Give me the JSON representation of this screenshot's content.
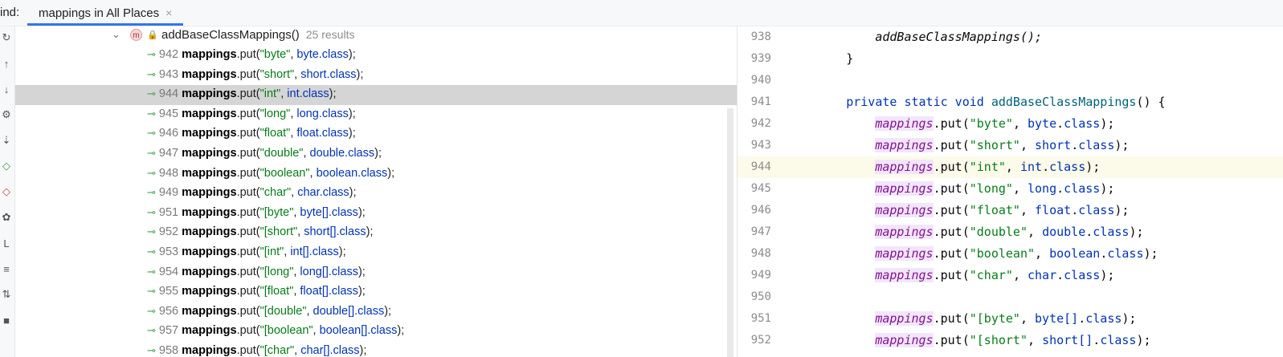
{
  "find": {
    "label": "ind:",
    "tab_label": "mappings in All Places",
    "close": "×"
  },
  "toolbar": {
    "icons": [
      "refresh-icon",
      "arrow-up-icon",
      "arrow-down-icon",
      "settings-icon",
      "tree-icon",
      "diamond-green-icon",
      "diamond-red-icon",
      "filter-icon",
      "text-icon",
      "align-icon",
      "sort-icon",
      "square-icon"
    ]
  },
  "tree": {
    "chevron": "⌄",
    "badge": "m",
    "method": "addBaseClassMappings()",
    "count": "25 results",
    "rows": [
      {
        "line": "942",
        "str": "\"byte\"",
        "cls": "byte.class"
      },
      {
        "line": "943",
        "str": "\"short\"",
        "cls": "short.class"
      },
      {
        "line": "944",
        "str": "\"int\"",
        "cls": "int.class"
      },
      {
        "line": "945",
        "str": "\"long\"",
        "cls": "long.class"
      },
      {
        "line": "946",
        "str": "\"float\"",
        "cls": "float.class"
      },
      {
        "line": "947",
        "str": "\"double\"",
        "cls": "double.class"
      },
      {
        "line": "948",
        "str": "\"boolean\"",
        "cls": "boolean.class"
      },
      {
        "line": "949",
        "str": "\"char\"",
        "cls": "char.class"
      },
      {
        "line": "951",
        "str": "\"[byte\"",
        "cls": "byte[].class"
      },
      {
        "line": "952",
        "str": "\"[short\"",
        "cls": "short[].class"
      },
      {
        "line": "953",
        "str": "\"[int\"",
        "cls": "int[].class"
      },
      {
        "line": "954",
        "str": "\"[long\"",
        "cls": "long[].class"
      },
      {
        "line": "955",
        "str": "\"[float\"",
        "cls": "float[].class"
      },
      {
        "line": "956",
        "str": "\"[double\"",
        "cls": "double[].class"
      },
      {
        "line": "957",
        "str": "\"[boolean\"",
        "cls": "boolean[].class"
      },
      {
        "line": "958",
        "str": "\"[char\"",
        "cls": "char[].class"
      }
    ],
    "field": "mappings",
    "put": ".put(",
    "comma": ", ",
    "end": ");"
  },
  "editor": {
    "lines": [
      {
        "num": "938",
        "indent": "        ",
        "text": "addBaseClassMappings();",
        "type": "call"
      },
      {
        "num": "939",
        "indent": "    ",
        "text": "}",
        "type": "plain"
      },
      {
        "num": "940",
        "indent": "",
        "text": "",
        "type": "plain"
      },
      {
        "num": "941",
        "indent": "    ",
        "text": "private static void addBaseClassMappings() {",
        "type": "decl"
      },
      {
        "num": "942",
        "indent": "        ",
        "str": "\"byte\"",
        "cls": "byte",
        "type": "put"
      },
      {
        "num": "943",
        "indent": "        ",
        "str": "\"short\"",
        "cls": "short",
        "type": "put"
      },
      {
        "num": "944",
        "indent": "        ",
        "str": "\"int\"",
        "cls": "int",
        "type": "put"
      },
      {
        "num": "945",
        "indent": "        ",
        "str": "\"long\"",
        "cls": "long",
        "type": "put"
      },
      {
        "num": "946",
        "indent": "        ",
        "str": "\"float\"",
        "cls": "float",
        "type": "put"
      },
      {
        "num": "947",
        "indent": "        ",
        "str": "\"double\"",
        "cls": "double",
        "type": "put"
      },
      {
        "num": "948",
        "indent": "        ",
        "str": "\"boolean\"",
        "cls": "boolean",
        "type": "put"
      },
      {
        "num": "949",
        "indent": "        ",
        "str": "\"char\"",
        "cls": "char",
        "type": "put"
      },
      {
        "num": "950",
        "indent": "",
        "text": "",
        "type": "plain"
      },
      {
        "num": "951",
        "indent": "        ",
        "str": "\"[byte\"",
        "cls": "byte[]",
        "type": "put"
      },
      {
        "num": "952",
        "indent": "        ",
        "str": "\"[short\"",
        "cls": "short[]",
        "type": "put"
      }
    ],
    "current_line": "944"
  }
}
